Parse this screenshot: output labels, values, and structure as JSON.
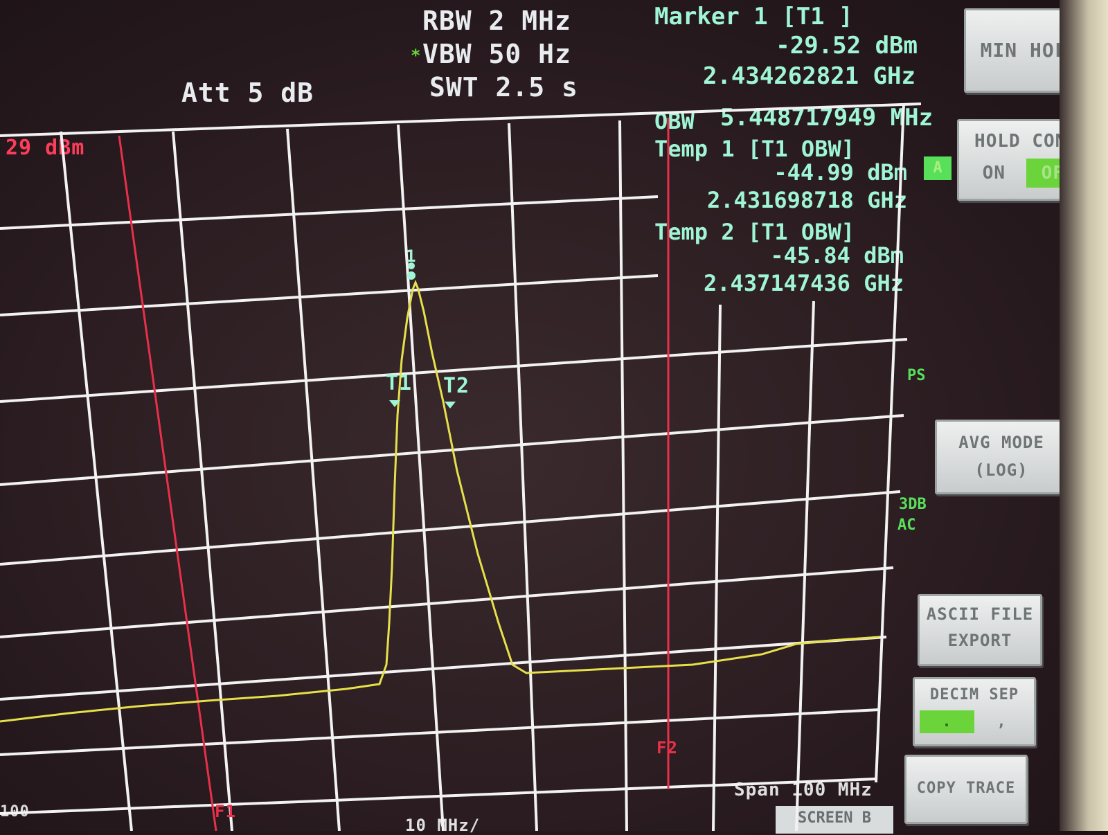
{
  "header": {
    "att": "Att  5 dB",
    "rbw": "RBW 2 MHz",
    "vbw": "VBW 50 Hz",
    "vbw_flag": "*",
    "swt": "SWT 2.5 s"
  },
  "ref_level": "29 dBm",
  "bottom_left": "100",
  "span": "Span 100 MHz",
  "screen_label": "SCREEN B",
  "per_div_partial": "10 MHz/",
  "marker1": {
    "title": "Marker 1 [T1 ]",
    "level": "-29.52 dBm",
    "freq": "2.434262821 GHz"
  },
  "obw": {
    "label": "OBW",
    "value": "5.448717949 MHz"
  },
  "temp1": {
    "title": "Temp 1 [T1 OBW]",
    "level": "-44.99 dBm",
    "freq": "2.431698718 GHz"
  },
  "temp2": {
    "title": "Temp 2 [T1 OBW]",
    "level": "-45.84 dBm",
    "freq": "2.437147436 GHz"
  },
  "trace_labels": {
    "t1": "T1",
    "t2": "T2",
    "m1": "1",
    "f1": "F1",
    "f2": "F2"
  },
  "side_flags": {
    "a": "A",
    "ps": "PS",
    "db3": "3DB",
    "ac": "AC"
  },
  "softkeys": {
    "min_hold": "MIN HOLD",
    "hold_cont": "HOLD CONT",
    "hold_on": "ON",
    "hold_off": "OFF",
    "avg_mode_1": "AVG MODE",
    "avg_mode_2": "(LOG)",
    "ascii_1": "ASCII FILE",
    "ascii_2": "EXPORT",
    "decim": "DECIM SEP",
    "decim_a": ".",
    "decim_b": ",",
    "copy_trace": "COPY TRACE"
  },
  "colors": {
    "grid": "#f2f2f2",
    "trace": "#e6e04a",
    "limit": "#e8304a",
    "marker": "#9ff5d6",
    "flag_green": "#58e05a"
  }
}
